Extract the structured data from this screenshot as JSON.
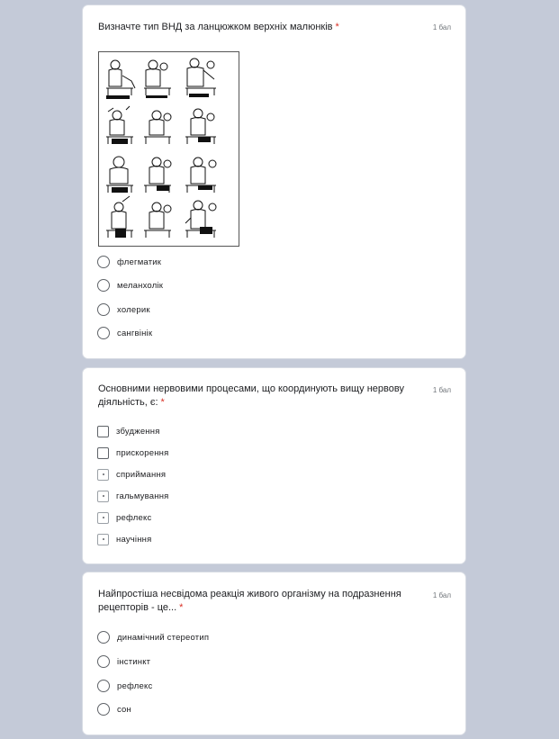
{
  "questions": [
    {
      "title": "Визначте тип ВНД за ланцюжком верхніх малюнків",
      "required_mark": "*",
      "points": "1 бал",
      "illustration": "cartoon-strip-temperaments",
      "type": "radio",
      "options": [
        "флегматик",
        "меланхолік",
        "холерик",
        "сангвінік"
      ]
    },
    {
      "title": "Основними нервовими процесами, що координують вищу нервову діяльність, є:",
      "required_mark": "*",
      "points": "1 бал",
      "type": "checkbox",
      "options": [
        "збудження",
        "прискорення",
        "сприймання",
        "гальмування",
        "рефлекс",
        "научіння"
      ]
    },
    {
      "title": "Найпростіша несвідома реакція живого організму на подразнення рецепторів - це...",
      "required_mark": "*",
      "points": "1 бал",
      "type": "radio",
      "options": [
        "динамічний стереотип",
        "інстинкт",
        "рефлекс",
        "сон"
      ]
    }
  ]
}
